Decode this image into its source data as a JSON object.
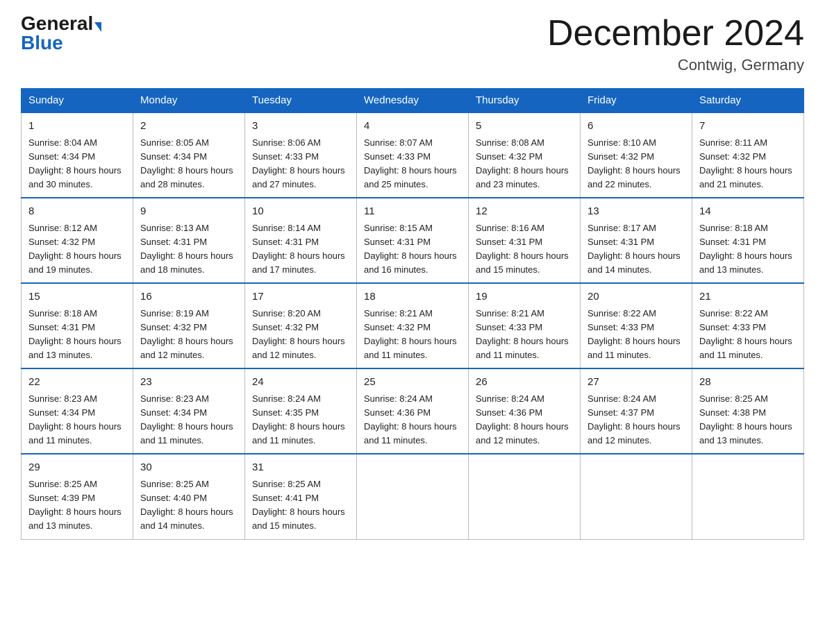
{
  "header": {
    "logo_general": "General",
    "logo_blue": "Blue",
    "month_title": "December 2024",
    "location": "Contwig, Germany"
  },
  "weekdays": [
    "Sunday",
    "Monday",
    "Tuesday",
    "Wednesday",
    "Thursday",
    "Friday",
    "Saturday"
  ],
  "weeks": [
    [
      {
        "day": "1",
        "sunrise": "8:04 AM",
        "sunset": "4:34 PM",
        "daylight": "8 hours and 30 minutes."
      },
      {
        "day": "2",
        "sunrise": "8:05 AM",
        "sunset": "4:34 PM",
        "daylight": "8 hours and 28 minutes."
      },
      {
        "day": "3",
        "sunrise": "8:06 AM",
        "sunset": "4:33 PM",
        "daylight": "8 hours and 27 minutes."
      },
      {
        "day": "4",
        "sunrise": "8:07 AM",
        "sunset": "4:33 PM",
        "daylight": "8 hours and 25 minutes."
      },
      {
        "day": "5",
        "sunrise": "8:08 AM",
        "sunset": "4:32 PM",
        "daylight": "8 hours and 23 minutes."
      },
      {
        "day": "6",
        "sunrise": "8:10 AM",
        "sunset": "4:32 PM",
        "daylight": "8 hours and 22 minutes."
      },
      {
        "day": "7",
        "sunrise": "8:11 AM",
        "sunset": "4:32 PM",
        "daylight": "8 hours and 21 minutes."
      }
    ],
    [
      {
        "day": "8",
        "sunrise": "8:12 AM",
        "sunset": "4:32 PM",
        "daylight": "8 hours and 19 minutes."
      },
      {
        "day": "9",
        "sunrise": "8:13 AM",
        "sunset": "4:31 PM",
        "daylight": "8 hours and 18 minutes."
      },
      {
        "day": "10",
        "sunrise": "8:14 AM",
        "sunset": "4:31 PM",
        "daylight": "8 hours and 17 minutes."
      },
      {
        "day": "11",
        "sunrise": "8:15 AM",
        "sunset": "4:31 PM",
        "daylight": "8 hours and 16 minutes."
      },
      {
        "day": "12",
        "sunrise": "8:16 AM",
        "sunset": "4:31 PM",
        "daylight": "8 hours and 15 minutes."
      },
      {
        "day": "13",
        "sunrise": "8:17 AM",
        "sunset": "4:31 PM",
        "daylight": "8 hours and 14 minutes."
      },
      {
        "day": "14",
        "sunrise": "8:18 AM",
        "sunset": "4:31 PM",
        "daylight": "8 hours and 13 minutes."
      }
    ],
    [
      {
        "day": "15",
        "sunrise": "8:18 AM",
        "sunset": "4:31 PM",
        "daylight": "8 hours and 13 minutes."
      },
      {
        "day": "16",
        "sunrise": "8:19 AM",
        "sunset": "4:32 PM",
        "daylight": "8 hours and 12 minutes."
      },
      {
        "day": "17",
        "sunrise": "8:20 AM",
        "sunset": "4:32 PM",
        "daylight": "8 hours and 12 minutes."
      },
      {
        "day": "18",
        "sunrise": "8:21 AM",
        "sunset": "4:32 PM",
        "daylight": "8 hours and 11 minutes."
      },
      {
        "day": "19",
        "sunrise": "8:21 AM",
        "sunset": "4:33 PM",
        "daylight": "8 hours and 11 minutes."
      },
      {
        "day": "20",
        "sunrise": "8:22 AM",
        "sunset": "4:33 PM",
        "daylight": "8 hours and 11 minutes."
      },
      {
        "day": "21",
        "sunrise": "8:22 AM",
        "sunset": "4:33 PM",
        "daylight": "8 hours and 11 minutes."
      }
    ],
    [
      {
        "day": "22",
        "sunrise": "8:23 AM",
        "sunset": "4:34 PM",
        "daylight": "8 hours and 11 minutes."
      },
      {
        "day": "23",
        "sunrise": "8:23 AM",
        "sunset": "4:34 PM",
        "daylight": "8 hours and 11 minutes."
      },
      {
        "day": "24",
        "sunrise": "8:24 AM",
        "sunset": "4:35 PM",
        "daylight": "8 hours and 11 minutes."
      },
      {
        "day": "25",
        "sunrise": "8:24 AM",
        "sunset": "4:36 PM",
        "daylight": "8 hours and 11 minutes."
      },
      {
        "day": "26",
        "sunrise": "8:24 AM",
        "sunset": "4:36 PM",
        "daylight": "8 hours and 12 minutes."
      },
      {
        "day": "27",
        "sunrise": "8:24 AM",
        "sunset": "4:37 PM",
        "daylight": "8 hours and 12 minutes."
      },
      {
        "day": "28",
        "sunrise": "8:25 AM",
        "sunset": "4:38 PM",
        "daylight": "8 hours and 13 minutes."
      }
    ],
    [
      {
        "day": "29",
        "sunrise": "8:25 AM",
        "sunset": "4:39 PM",
        "daylight": "8 hours and 13 minutes."
      },
      {
        "day": "30",
        "sunrise": "8:25 AM",
        "sunset": "4:40 PM",
        "daylight": "8 hours and 14 minutes."
      },
      {
        "day": "31",
        "sunrise": "8:25 AM",
        "sunset": "4:41 PM",
        "daylight": "8 hours and 15 minutes."
      },
      null,
      null,
      null,
      null
    ]
  ],
  "labels": {
    "sunrise": "Sunrise:",
    "sunset": "Sunset:",
    "daylight": "Daylight:"
  }
}
